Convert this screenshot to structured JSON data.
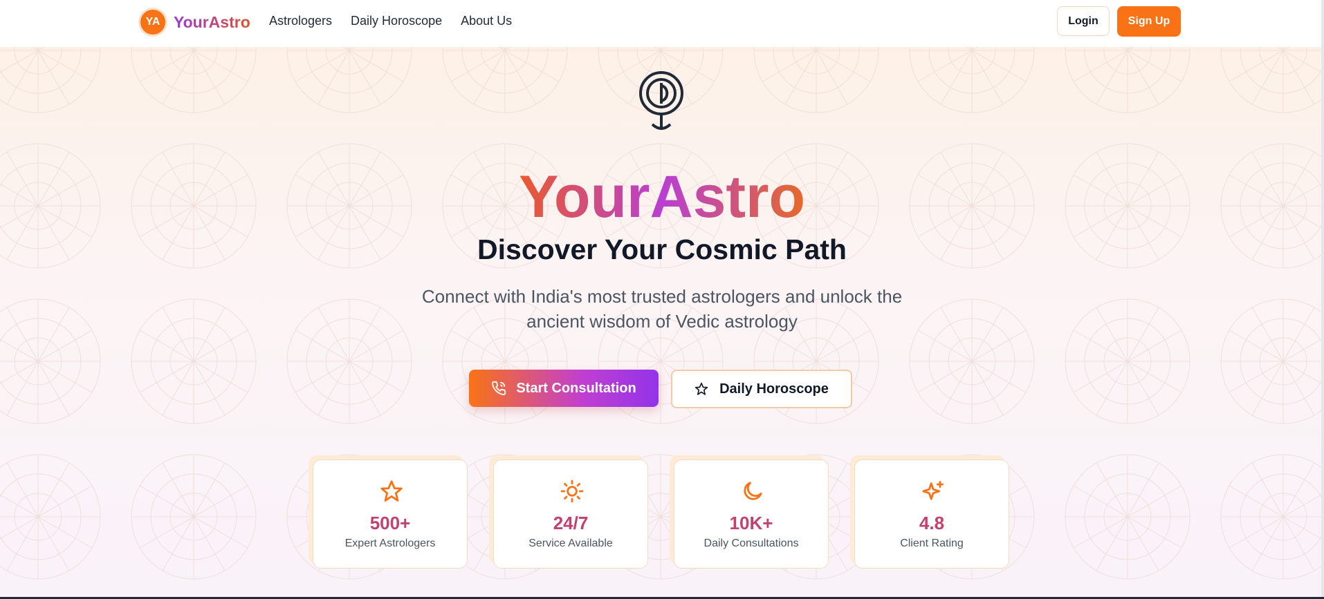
{
  "nav": {
    "brand_initials": "YA",
    "brand_name": "YourAstro",
    "links": [
      "Astrologers",
      "Daily Horoscope",
      "About Us"
    ],
    "login_label": "Login",
    "signup_label": "Sign Up"
  },
  "hero": {
    "logo_icon": "astro-seal-icon",
    "title": "YourAstro",
    "subtitle": "Discover Your Cosmic Path",
    "description": "Connect with India's most trusted astrologers and unlock the ancient wisdom of Vedic astrology",
    "primary_cta": {
      "label": "Start Consultation",
      "icon": "phone-icon"
    },
    "secondary_cta": {
      "label": "Daily Horoscope",
      "icon": "star-outline-icon"
    }
  },
  "stats": [
    {
      "icon": "star-icon",
      "value": "500+",
      "label": "Expert Astrologers"
    },
    {
      "icon": "sun-icon",
      "value": "24/7",
      "label": "Service Available"
    },
    {
      "icon": "moon-icon",
      "value": "10K+",
      "label": "Daily Consultations"
    },
    {
      "icon": "sparkles-icon",
      "value": "4.8",
      "label": "Client Rating"
    }
  ],
  "colors": {
    "accent_orange": "#f97316",
    "accent_purple": "#9333ea",
    "stat_value": "#c4416d",
    "text_dark": "#111827",
    "text_muted": "#4b5563"
  }
}
